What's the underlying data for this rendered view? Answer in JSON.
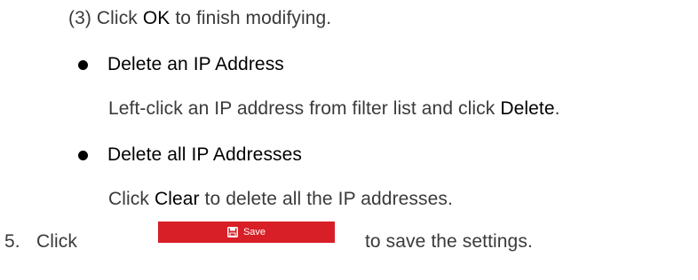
{
  "step3": {
    "prefix": "(3) Click ",
    "bold": "OK",
    "suffix": " to finish modifying."
  },
  "delete_ip": {
    "heading": "Delete an IP Address",
    "text_prefix": "Left-click an IP address from filter list and click ",
    "text_bold": "Delete",
    "text_suffix": "."
  },
  "delete_all": {
    "heading": "Delete all IP Addresses",
    "text_prefix": "Click ",
    "text_bold": "Clear",
    "text_suffix": " to delete all the IP addresses."
  },
  "step5": {
    "number": "5.",
    "click": "Click",
    "suffix": "to save the settings.",
    "button_label": "Save",
    "button_icon": "save-icon",
    "button_color": "#d81e26"
  }
}
